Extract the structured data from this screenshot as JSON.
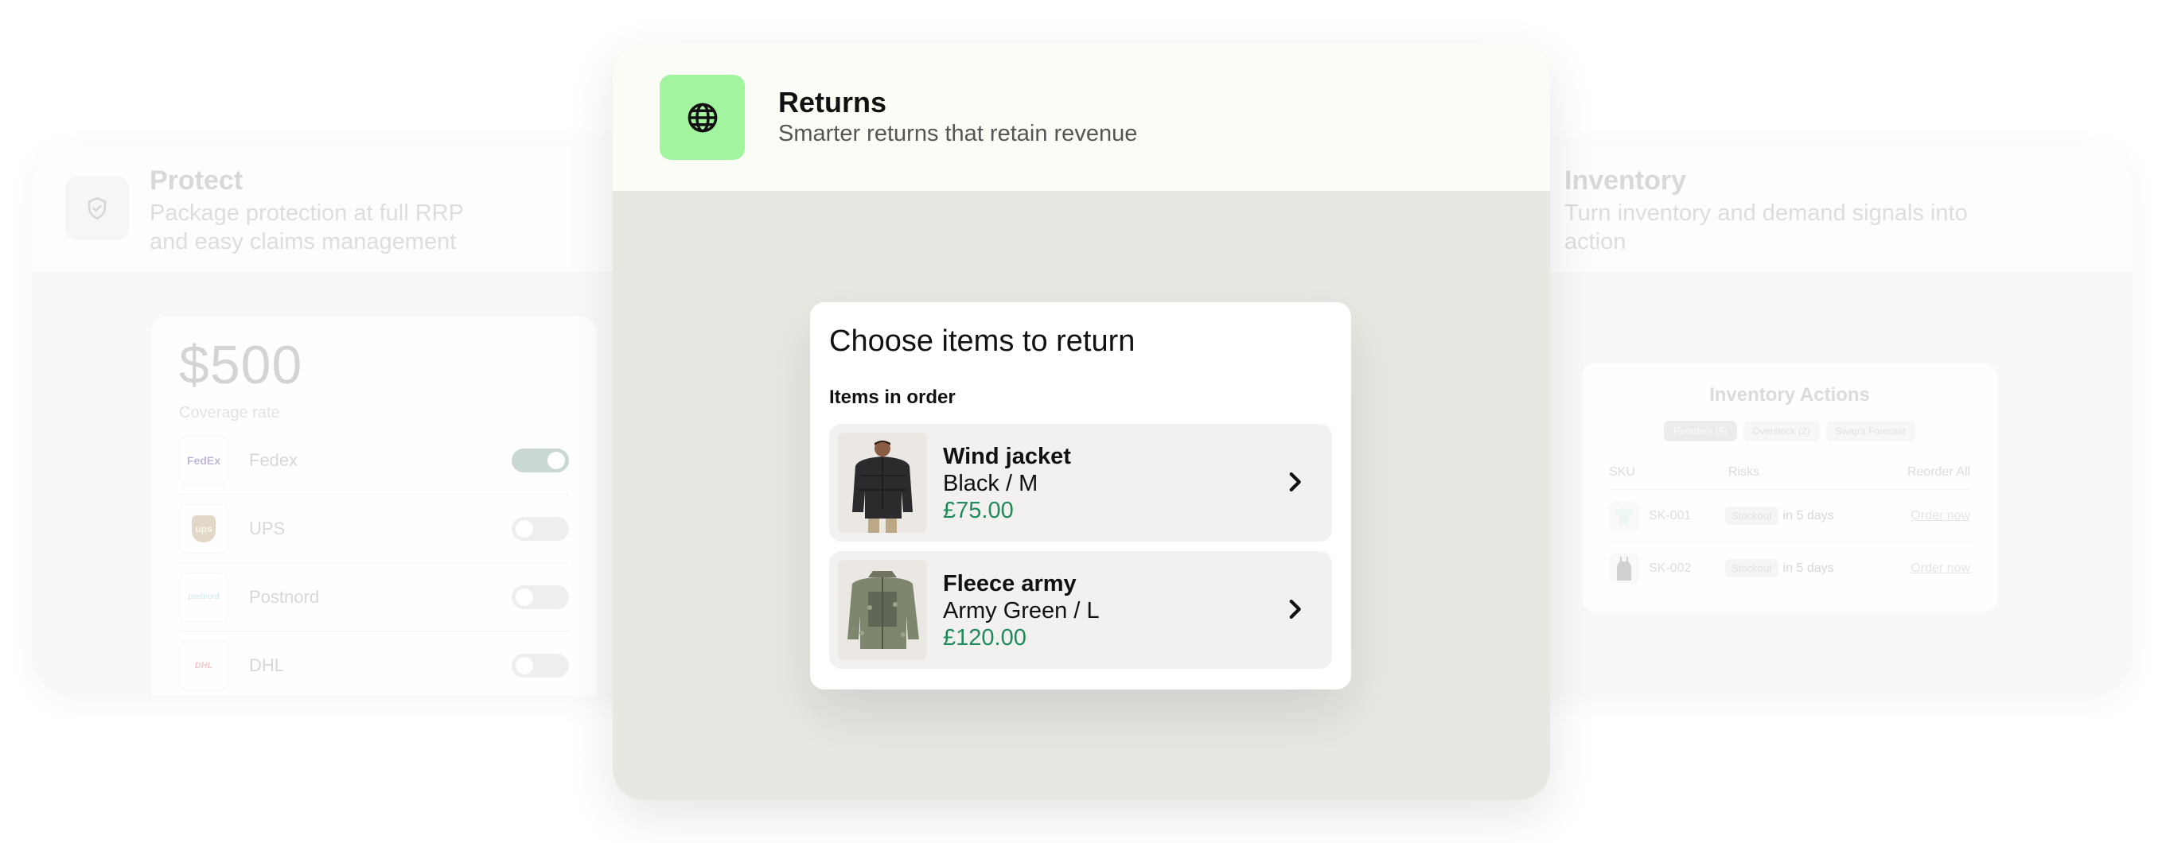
{
  "protect": {
    "title": "Protect",
    "subtitle_line1": "Package protection at full RRP",
    "subtitle_line2": "and easy claims management",
    "icon": "shield-check-icon",
    "amount": "$500",
    "amount_label": "Coverage rate",
    "carriers": [
      {
        "name": "Fedex",
        "logo_text": "FedEx",
        "enabled": true
      },
      {
        "name": "UPS",
        "logo_text": "ups",
        "enabled": false
      },
      {
        "name": "Postnord",
        "logo_text": "postnord",
        "enabled": false
      },
      {
        "name": "DHL",
        "logo_text": "DHL",
        "enabled": false
      }
    ]
  },
  "returns": {
    "title": "Returns",
    "subtitle": "Smarter returns that retain revenue",
    "icon": "globe-icon",
    "accent": "#a2f59e",
    "modal": {
      "title": "Choose items to return",
      "section": "Items in order",
      "items": [
        {
          "name": "Wind jacket",
          "variant": "Black / M",
          "price": "£75.00"
        },
        {
          "name": "Fleece army",
          "variant": "Army Green / L",
          "price": "£120.00"
        }
      ]
    },
    "price_color": "#1f8a5b"
  },
  "inventory": {
    "title": "Inventory",
    "subtitle_line1": "Turn inventory and demand signals into",
    "subtitle_line2": "action",
    "panel_title": "Inventory Actions",
    "chips": [
      "Reorders (5)",
      "Overstock (2)",
      "Swap's Forecast"
    ],
    "columns": {
      "sku": "SKU",
      "risks": "Risks",
      "reorder": "Reorder All"
    },
    "rows": [
      {
        "sku": "SK-001",
        "badge": "Stockout",
        "risk": "in 5 days",
        "action": "Order now"
      },
      {
        "sku": "SK-002",
        "badge": "Stockout",
        "risk": "in 5 days",
        "action": "Order now"
      }
    ]
  }
}
